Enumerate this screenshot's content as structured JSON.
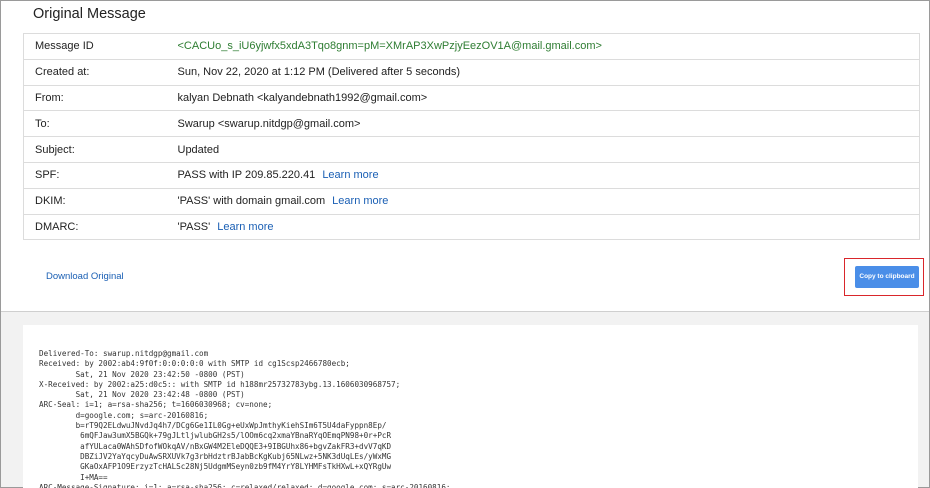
{
  "title": "Original Message",
  "headers": [
    {
      "key": "Message ID",
      "value": "<CACUo_s_iU6yjwfx5xdA3Tqo8gnm=pM=XMrAP3XwPzjyEezOV1A@mail.gmail.com>",
      "green": true,
      "link": ""
    },
    {
      "key": "Created at:",
      "value": "Sun, Nov 22, 2020 at 1:12 PM (Delivered after 5 seconds)",
      "green": false,
      "link": ""
    },
    {
      "key": "From:",
      "value": "kalyan Debnath <kalyandebnath1992@gmail.com>",
      "green": false,
      "link": ""
    },
    {
      "key": "To:",
      "value": "Swarup <swarup.nitdgp@gmail.com>",
      "green": false,
      "link": ""
    },
    {
      "key": "Subject:",
      "value": "Updated",
      "green": false,
      "link": ""
    },
    {
      "key": "SPF:",
      "value": "PASS with IP 209.85.220.41",
      "green": false,
      "link": "Learn more"
    },
    {
      "key": "DKIM:",
      "value": "'PASS' with domain gmail.com",
      "green": false,
      "link": "Learn more"
    },
    {
      "key": "DMARC:",
      "value": "'PASS'",
      "green": false,
      "link": "Learn more"
    }
  ],
  "download_label": "Download Original",
  "copy_label": "Copy to clipboard",
  "raw_lines": [
    "Delivered-To: swarup.nitdgp@gmail.com",
    "Received: by 2002:ab4:9f0f:0:0:0:0:0 with SMTP id cg1Scsp2466780ecb;",
    "        Sat, 21 Nov 2020 23:42:50 -0800 (PST)",
    "X-Received: by 2002:a25:d0c5:: with SMTP id h188mr25732783ybg.13.1606030968757;",
    "        Sat, 21 Nov 2020 23:42:48 -0800 (PST)",
    "ARC-Seal: i=1; a=rsa-sha256; t=1606030968; cv=none;",
    "        d=google.com; s=arc-20160816;",
    "        b=rT9Q2ELdwuJNvdJq4h7/DCg6Ge1IL0Gg+eUxWpJmthyKiehSIm6T5U4daFyppn8Ep/",
    "         6mQFJaw3umX5BGQk+79gJLtljwlubGH2s5/lOOm6cq2xmaYBnaRYqOEmqPN98+0r+PcR",
    "         afYULaca0WAhSDfofWOkqAV/nBxGW4M2EleDQQE3+9IBGUhx86+bgvZakFR3+dvV7qKD",
    "         DBZiJV2YaYqcyDuAwSRXUVk7g3rbHdztrBJabBcKgKubj65NLwz+5NK3dUqLEs/yWxMG",
    "         GKaOxAFP1O9ErzyzTcHALSc28Nj5UdgmMSeyn0zb9fM4YrY8LYHMFsTkHXwL+xQYRgUw",
    "         I+MA==",
    "ARC-Message-Signature: i=1; a=rsa-sha256; c=relaxed/relaxed; d=google.com; s=arc-20160816;"
  ]
}
